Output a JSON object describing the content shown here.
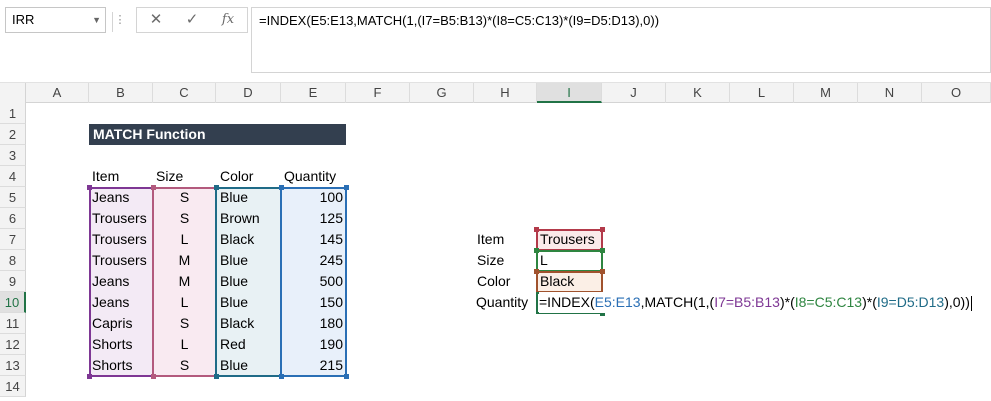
{
  "name_box": "IRR",
  "formula_bar": {
    "cancel_icon": "close-icon",
    "enter_icon": "check-icon",
    "function_label": "fx",
    "formula": "=INDEX(E5:E13,MATCH(1,(I7=B5:B13)*(I8=C5:C13)*(I9=D5:D13),0))"
  },
  "columns": [
    "A",
    "B",
    "C",
    "D",
    "E",
    "F",
    "G",
    "H",
    "I",
    "J",
    "K",
    "L",
    "M",
    "N",
    "O"
  ],
  "rows": [
    "1",
    "2",
    "3",
    "4",
    "5",
    "6",
    "7",
    "8",
    "9",
    "10",
    "11",
    "12",
    "13",
    "14"
  ],
  "selected_column": "I",
  "selected_row": "10",
  "sheet": {
    "title": "MATCH Function",
    "headers": {
      "item": "Item",
      "size": "Size",
      "color": "Color",
      "quantity": "Quantity"
    },
    "table": [
      {
        "item": "Jeans",
        "size": "S",
        "color": "Blue",
        "quantity": "100"
      },
      {
        "item": "Trousers",
        "size": "S",
        "color": "Brown",
        "quantity": "125"
      },
      {
        "item": "Trousers",
        "size": "L",
        "color": "Black",
        "quantity": "145"
      },
      {
        "item": "Trousers",
        "size": "M",
        "color": "Blue",
        "quantity": "245"
      },
      {
        "item": "Jeans",
        "size": "M",
        "color": "Blue",
        "quantity": "500"
      },
      {
        "item": "Jeans",
        "size": "L",
        "color": "Blue",
        "quantity": "150"
      },
      {
        "item": "Capris",
        "size": "S",
        "color": "Black",
        "quantity": "180"
      },
      {
        "item": "Shorts",
        "size": "L",
        "color": "Red",
        "quantity": "190"
      },
      {
        "item": "Shorts",
        "size": "S",
        "color": "Blue",
        "quantity": "215"
      }
    ],
    "lookup": {
      "item_label": "Item",
      "item_value": "Trousers",
      "size_label": "Size",
      "size_value": "L",
      "color_label": "Color",
      "color_value": "Black",
      "quantity_label": "Quantity"
    },
    "cell_formula_parts": {
      "p1": "=INDEX(",
      "p2": "E5:E13",
      "p3": ",MATCH(1,(",
      "p4": "I7=B5:B13",
      "p5": ")*(",
      "p6": "I8=C5:C13",
      "p7": ")*(",
      "p8": "I9=D5:D13",
      "p9": "),0))"
    }
  },
  "colors": {
    "title_band": "#333f4f",
    "range_item": "#7e3794",
    "range_size": "#b35a7d",
    "range_color": "#1f6b87",
    "range_quantity": "#2a6fb5",
    "lookup_item": "#b33a4a",
    "lookup_size": "#2e8540",
    "lookup_color": "#a0522d",
    "selection": "#217346"
  }
}
